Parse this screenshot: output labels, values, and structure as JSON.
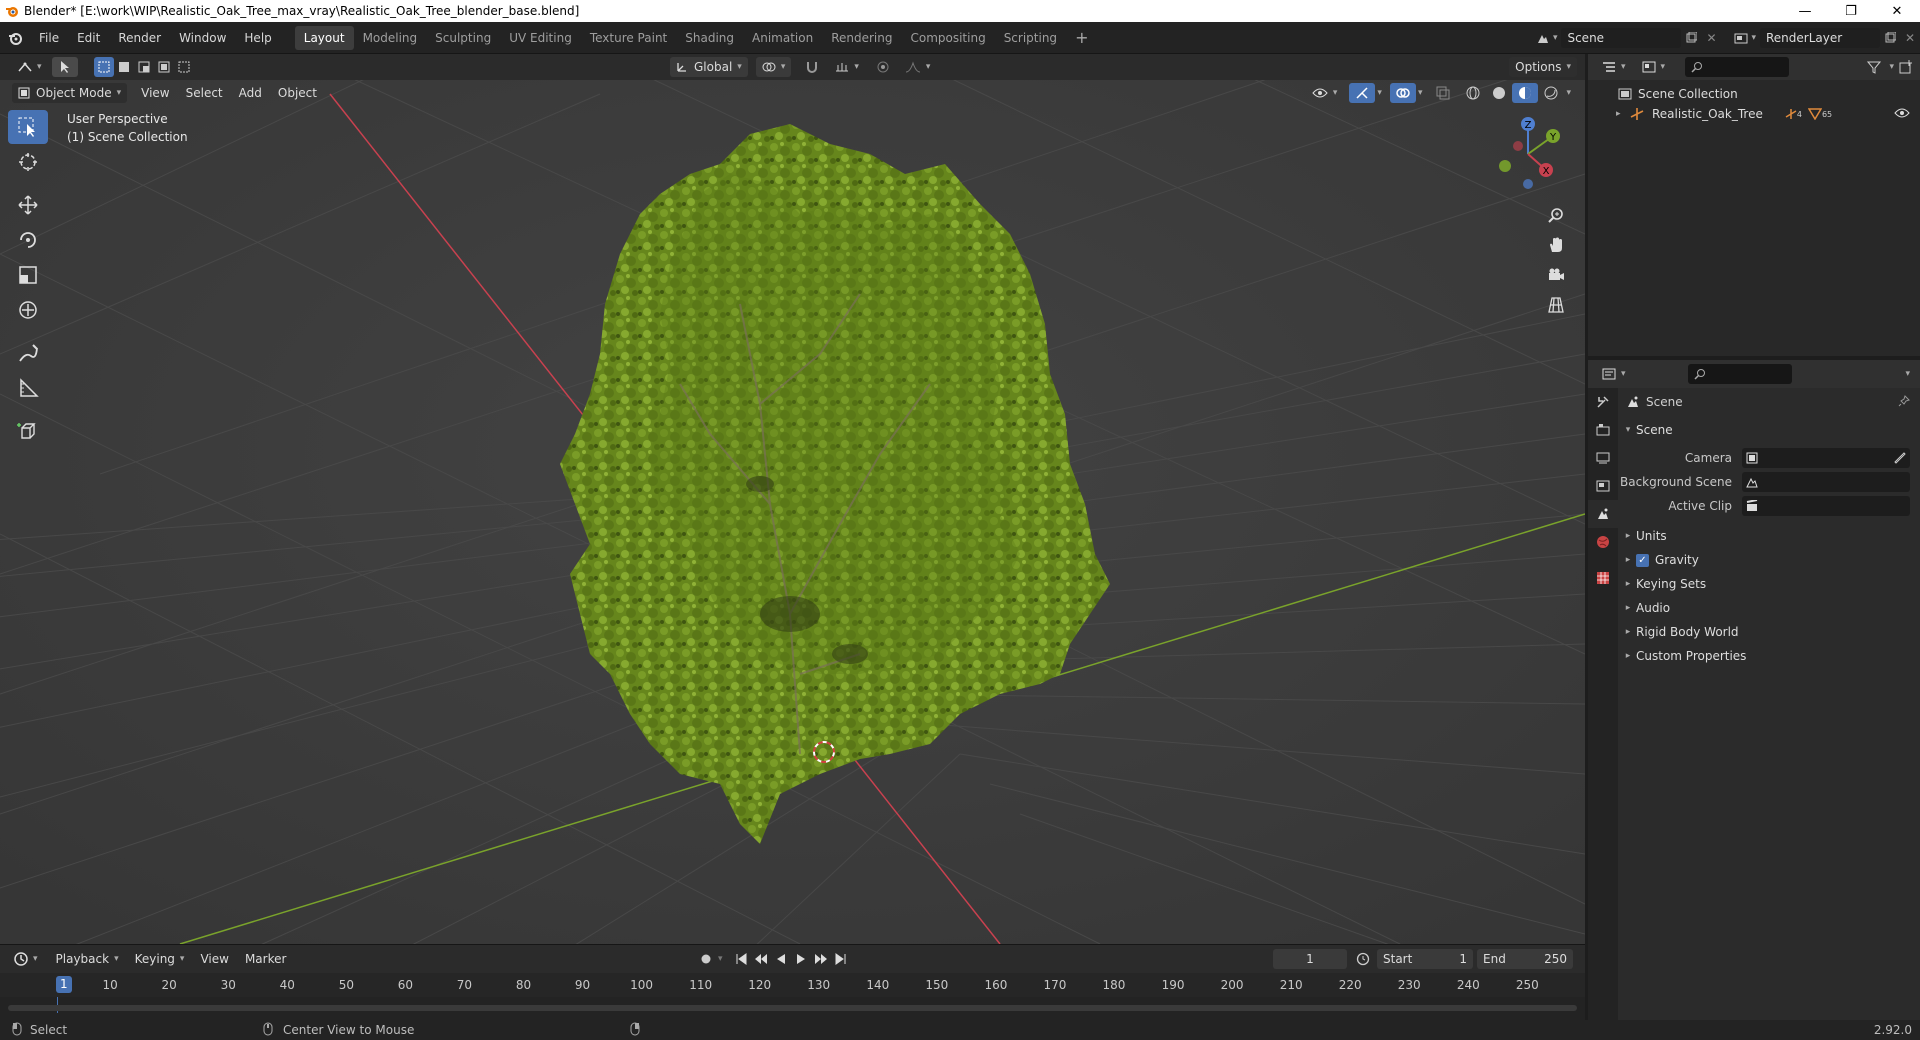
{
  "window": {
    "title": "Blender* [E:\\work\\WIP\\Realistic_Oak_Tree_max_vray\\Realistic_Oak_Tree_blender_base.blend]",
    "controls": [
      "—",
      "❐",
      "✕"
    ]
  },
  "menu": {
    "items": [
      "File",
      "Edit",
      "Render",
      "Window",
      "Help"
    ],
    "workspaces": [
      "Layout",
      "Modeling",
      "Sculpting",
      "UV Editing",
      "Texture Paint",
      "Shading",
      "Animation",
      "Rendering",
      "Compositing",
      "Scripting"
    ],
    "active_workspace": "Layout",
    "add_workspace": "+",
    "scene_name": "Scene",
    "render_layer": "RenderLayer"
  },
  "viewport_header": {
    "transform_orientation": "Global",
    "options_label": "Options",
    "mode": "Object Mode",
    "menus": [
      "View",
      "Select",
      "Add",
      "Object"
    ]
  },
  "viewport": {
    "perspective_label": "User Perspective",
    "collection_label": "(1) Scene Collection",
    "gizmo_axes": {
      "x": "X",
      "y": "Y",
      "z": "Z"
    },
    "colors": {
      "background": "#3d3d3d",
      "x_axis": "#c8414f",
      "y_axis": "#7aa32b",
      "foliage": "#6a8a1e"
    }
  },
  "timeline": {
    "menus": [
      "Playback",
      "Keying",
      "View",
      "Marker"
    ],
    "current_frame": "1",
    "start_label": "Start",
    "start": "1",
    "end_label": "End",
    "end": "250",
    "ruler_cursor": "1",
    "ruler_ticks": [
      "10",
      "20",
      "30",
      "40",
      "50",
      "60",
      "70",
      "80",
      "90",
      "100",
      "110",
      "120",
      "130",
      "140",
      "150",
      "160",
      "170",
      "180",
      "190",
      "200",
      "210",
      "220",
      "230",
      "240",
      "250"
    ]
  },
  "statusbar": {
    "left_action": "Select",
    "middle_action": "Center View to Mouse",
    "version": "2.92.0"
  },
  "outliner": {
    "root": "Scene Collection",
    "item": "Realistic_Oak_Tree",
    "item_badge_1": "4",
    "item_badge_2": "65"
  },
  "properties": {
    "context": "Scene",
    "section": "Scene",
    "camera_label": "Camera",
    "background_scene_label": "Background Scene",
    "active_clip_label": "Active Clip",
    "panels": [
      "Units",
      "Gravity",
      "Keying Sets",
      "Audio",
      "Rigid Body World",
      "Custom Properties"
    ]
  }
}
